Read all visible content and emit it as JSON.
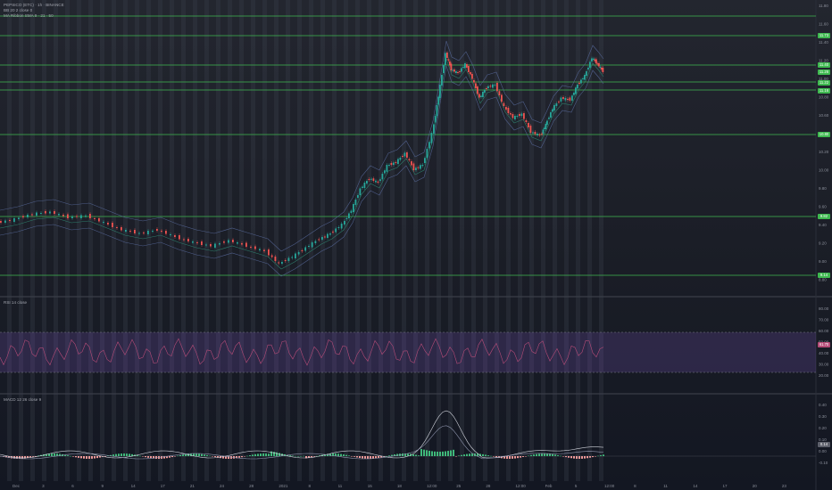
{
  "legend": {
    "symbol_line": "PEPSICO (ETC) · 1h · BINANCE",
    "ind1": "BB 20 2 close 0",
    "ind2": "MA Ribbon  SMA 9 · 21 · 50",
    "rsi": "RSI 14 close",
    "macd": "MACD 12 26 close 9"
  },
  "chart_data": {
    "type": "line",
    "title": "",
    "price_axis": [
      "11.80",
      "11.60",
      "11.40",
      "11.20",
      "11.00",
      "10.80",
      "10.60",
      "10.40",
      "10.20",
      "10.00",
      "9.80",
      "9.60",
      "9.40",
      "9.20",
      "9.00",
      "8.80"
    ],
    "rsi_axis": [
      "80.00",
      "70.00",
      "60.00",
      "50.00",
      "40.00",
      "30.00",
      "20.00"
    ],
    "macd_axis": [
      "0.40",
      "0.30",
      "0.20",
      "0.10",
      "0.00",
      "-0.10"
    ],
    "x_tick_labels": [
      "Dec",
      "3",
      "6",
      "9",
      "14",
      "17",
      "21",
      "24",
      "28",
      "2021",
      "8",
      "11",
      "15",
      "18",
      "12:00",
      "25",
      "28",
      "12:00",
      "Feb",
      "5",
      "12:00",
      "8",
      "11",
      "14",
      "17",
      "20",
      "23"
    ],
    "price_tags": [
      "11.73",
      "11.40",
      "11.26",
      "11.22",
      "11.16",
      "10.80",
      "9.82",
      "9.14"
    ],
    "rsi_tag": "61.70",
    "macd_tag": "0.14"
  },
  "colors": {
    "up": "#26a69a",
    "down": "#ef5350",
    "level": "#3fb950",
    "rsi": "#b54c78",
    "band": "#7e57c2",
    "macd": "#d1d4dc",
    "signal": "#8d93ab"
  }
}
